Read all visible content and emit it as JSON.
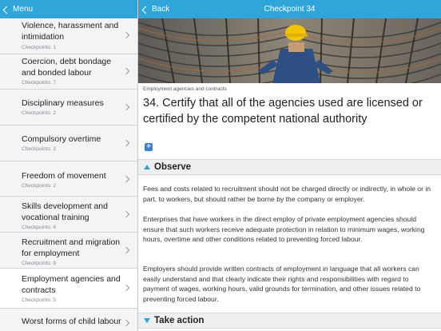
{
  "sidebar": {
    "back_label": "Menu",
    "items": [
      {
        "title": "Violence, harassment and intimidation",
        "count": "Checkpoints: 1"
      },
      {
        "title": "Coercion, debt bondage and bonded labour",
        "count": "Checkpoints: 7"
      },
      {
        "title": "Disciplinary measures",
        "count": "Checkpoints: 2"
      },
      {
        "title": "Compulsory overtime",
        "count": "Checkpoints: 2"
      },
      {
        "title": "Freedom of movement",
        "count": "Checkpoints: 2"
      },
      {
        "title": "Skills development and vocational training",
        "count": "Checkpoints: 4"
      },
      {
        "title": "Recruitment and migration for employment",
        "count": "Checkpoints: 9"
      },
      {
        "title": "Employment agencies and contracts",
        "count": "Checkpoints: 5"
      },
      {
        "title": "Worst forms of child labour",
        "count": ""
      }
    ]
  },
  "main": {
    "back_label": "Back",
    "title": "Checkpoint 34",
    "category": "Employment agencies and contracts",
    "heading": "34. Certify that all of the agencies used are licensed or certified by the competent national authority",
    "expand_icon": "+",
    "observe_title": "Observe",
    "paragraphs": [
      "Fees and costs related to recruitment should not be charged directly or indirectly, in whole or in part, to workers, but should rather be borne by the company or employer.",
      "Enterprises that have workers in the direct employ of private employment agencies should ensure that such workers receive adequate protection in relation to minimum wages, working hours, overtime and other conditions related to preventing forced labour.",
      "Employers should provide written contracts of employment in language that all workers can easily understand and that clearly indicate their rights and responsibilities with regard to payment of wages, working hours, valid grounds for termination, and other issues related to preventing forced labour."
    ],
    "action_title": "Take action"
  },
  "colors": {
    "accent": "#30a5da",
    "sidebar_bg": "#f4f4f7",
    "selected_bg": "#ffffff"
  }
}
